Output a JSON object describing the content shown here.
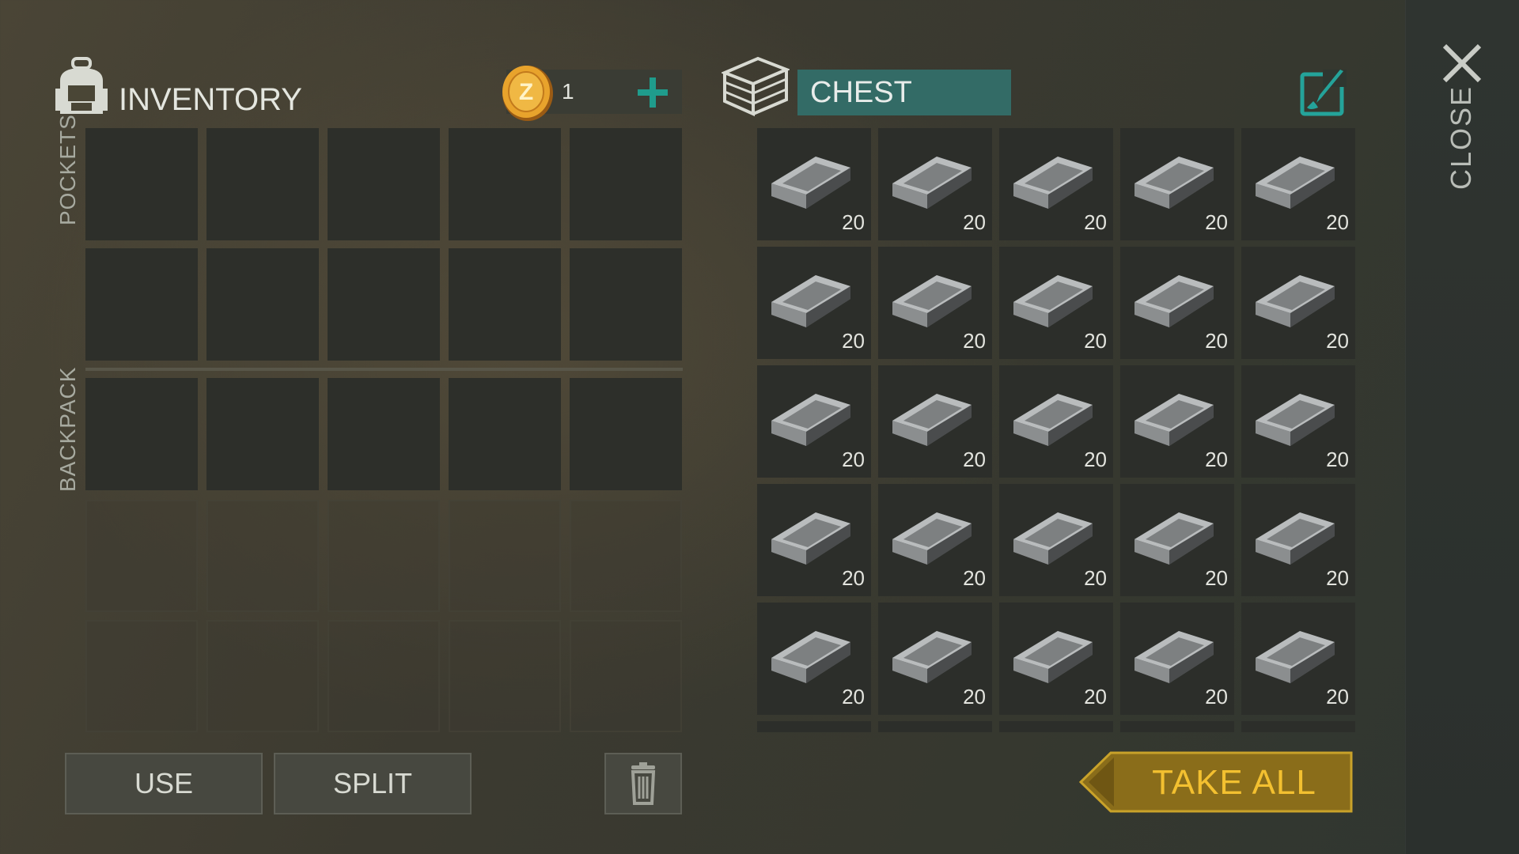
{
  "close": {
    "label": "CLOSE",
    "icon": "close-icon"
  },
  "inventory": {
    "title": "INVENTORY",
    "icon": "backpack-icon",
    "coins": {
      "count": "1",
      "icon": "coin-icon",
      "add_icon": "plus-icon"
    },
    "sections": {
      "pockets": "POCKETS",
      "backpack": "BACKPACK"
    },
    "pocket_rows": 2,
    "backpack_open_rows": 1,
    "backpack_locked_rows": 2,
    "columns": 5
  },
  "chest": {
    "title": "CHEST",
    "icon": "chest-icon",
    "edit_icon": "edit-paint-icon",
    "item_icon": "iron-ingot-icon",
    "slots": [
      {
        "qty": "20"
      },
      {
        "qty": "20"
      },
      {
        "qty": "20"
      },
      {
        "qty": "20"
      },
      {
        "qty": "20"
      },
      {
        "qty": "20"
      },
      {
        "qty": "20"
      },
      {
        "qty": "20"
      },
      {
        "qty": "20"
      },
      {
        "qty": "20"
      },
      {
        "qty": "20"
      },
      {
        "qty": "20"
      },
      {
        "qty": "20"
      },
      {
        "qty": "20"
      },
      {
        "qty": "20"
      },
      {
        "qty": "20"
      },
      {
        "qty": "20"
      },
      {
        "qty": "20"
      },
      {
        "qty": "20"
      },
      {
        "qty": "20"
      },
      {
        "qty": "20"
      },
      {
        "qty": "20"
      },
      {
        "qty": "20"
      },
      {
        "qty": "20"
      },
      {
        "qty": "20"
      }
    ]
  },
  "actions": {
    "use": "USE",
    "split": "SPLIT",
    "trash_icon": "trash-icon",
    "take_all": "TAKE ALL"
  },
  "colors": {
    "accent_teal": "#336b66",
    "take_all_gold": "#8a6d1a",
    "take_all_text": "#f3c030",
    "plus_teal": "#1f9c8c"
  }
}
